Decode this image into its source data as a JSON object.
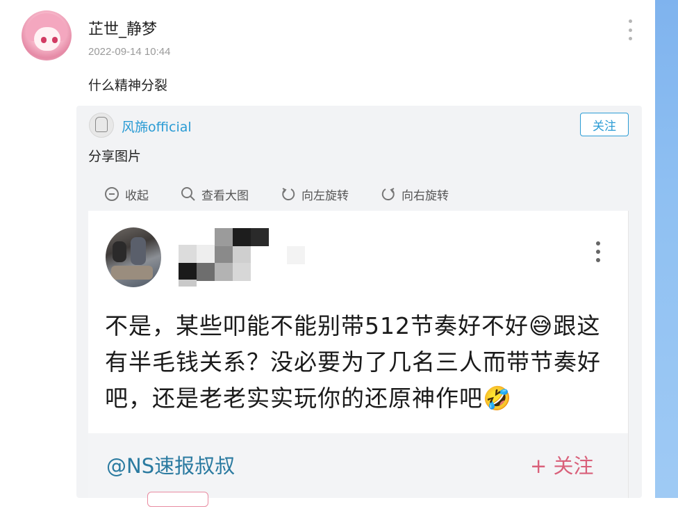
{
  "post": {
    "username": "芷世_静梦",
    "timestamp": "2022-09-14 10:44",
    "text": "什么精神分裂"
  },
  "repost": {
    "username": "风旆official",
    "follow_label": "关注",
    "text": "分享图片",
    "toolbar": [
      {
        "label": "收起",
        "icon": "collapse-icon"
      },
      {
        "label": "查看大图",
        "icon": "search-icon"
      },
      {
        "label": "向左旋转",
        "icon": "rotate-left-icon"
      },
      {
        "label": "向右旋转",
        "icon": "rotate-right-icon"
      }
    ]
  },
  "image_content": {
    "message": "不是，某些叩能不能别带512节奏好不好😅跟这有半毛钱关系？没必要为了几名三人而带节奏好吧，还是老老实实玩你的还原神作吧🤣",
    "handle": "@NS速报叔叔",
    "follow_label": "+ 关注"
  },
  "colors": {
    "accent": "#2a9bd4",
    "image_follow": "#d9607a",
    "right_strip": "#8fc0f2"
  }
}
